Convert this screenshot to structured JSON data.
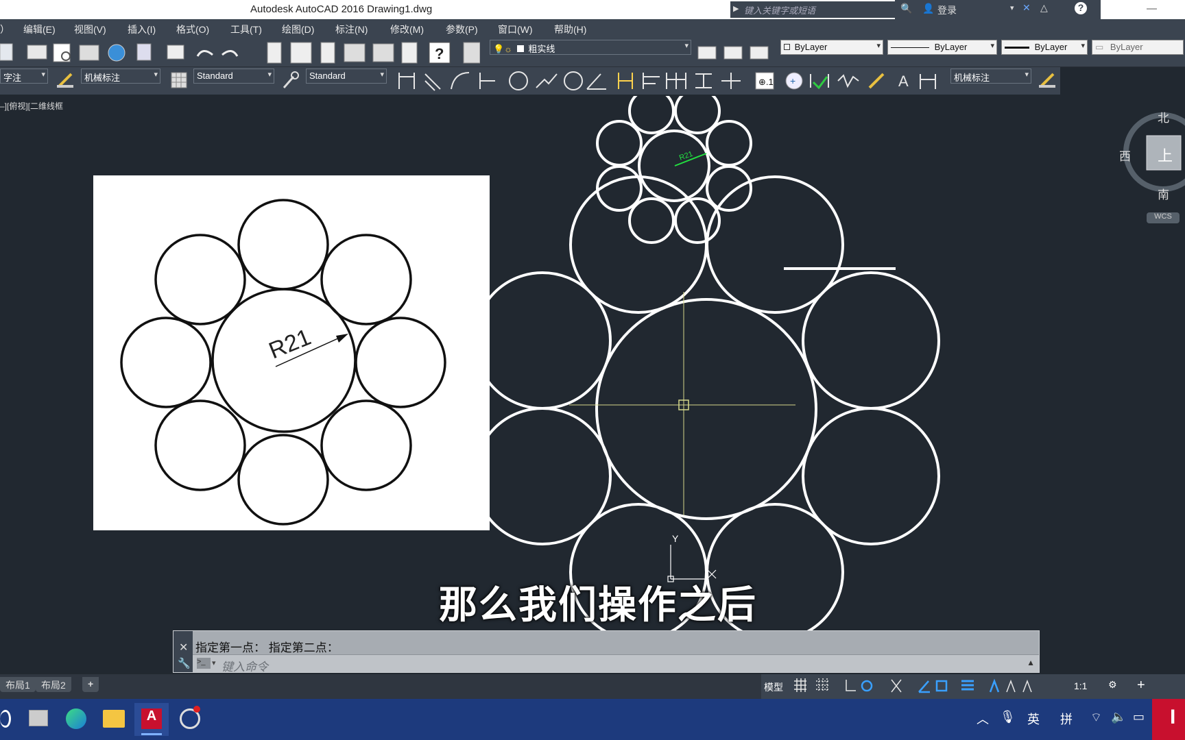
{
  "titlebar": {
    "app_title": "Autodesk AutoCAD 2016    Drawing1.dwg",
    "search_placeholder": "键入关键字或短语",
    "login": "登录"
  },
  "menu": [
    "）",
    "编辑(E)",
    "视图(V)",
    "插入(I)",
    "格式(O)",
    "工具(T)",
    "绘图(D)",
    "标注(N)",
    "修改(M)",
    "参数(P)",
    "窗口(W)",
    "帮助(H)"
  ],
  "toolbar1": {
    "layer_combo": "粗实线",
    "color_combo": "ByLayer",
    "linetype_combo": "ByLayer",
    "lineweight_combo": "ByLayer",
    "plotstyle_combo": "ByLayer"
  },
  "toolbar2": {
    "text_style_combo": "字注",
    "dim_style_combo": "机械标注",
    "table_style_combo": "Standard",
    "multileader_style_combo": "Standard",
    "dim_style_combo_right": "机械标注"
  },
  "viewport": {
    "label": "–][俯视][二维线框",
    "reference_dimension": "R21",
    "drawing_dimension": "R21",
    "ucs_y": "Y"
  },
  "viewcube": {
    "north": "北",
    "west": "西",
    "south": "南",
    "top_face": "上",
    "wcs": "WCS"
  },
  "subtitle": "那么我们操作之后",
  "command": {
    "history": "指定第一点：  指定第二点：",
    "placeholder": "键入命令"
  },
  "layout_tabs": [
    "布局1",
    "布局2"
  ],
  "statusbar": {
    "model": "模型",
    "scale": "1:1"
  },
  "taskbar": {
    "ime_lang": "英",
    "ime_mode": "拼"
  },
  "colors": {
    "ui_bg": "#3b4450",
    "canvas_bg": "#212830",
    "crosshair": "#d6d88a",
    "dimension": "#22e040",
    "taskbar": "#1d3a7d"
  }
}
